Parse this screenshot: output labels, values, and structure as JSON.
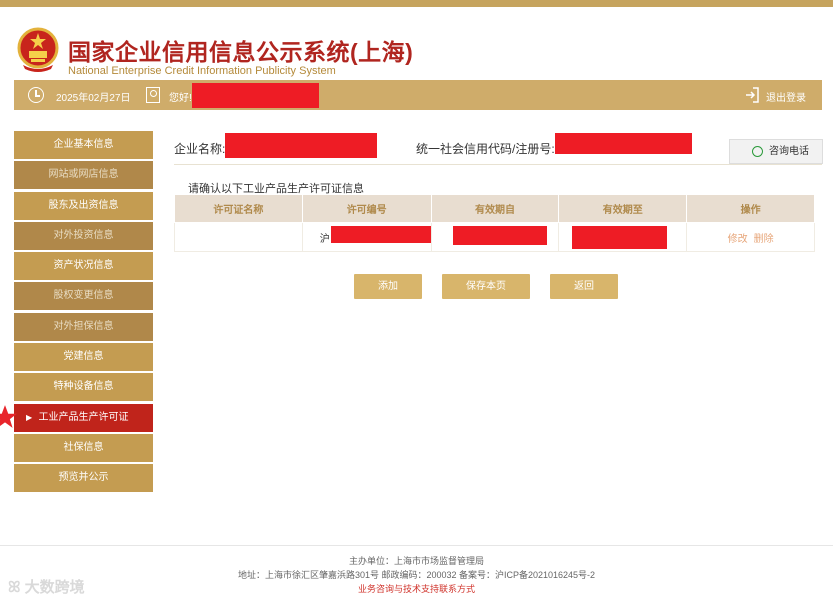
{
  "header": {
    "title_cn": "国家企业信用信息公示系统(上海)",
    "title_en": "National Enterprise Credit Information Publicity System"
  },
  "infobar": {
    "date": "2025年02月27日",
    "hello": "您好!",
    "logout": "退出登录"
  },
  "sidebar": {
    "items": [
      {
        "label": "企业基本信息"
      },
      {
        "label": "网站或网店信息"
      },
      {
        "label": "股东及出资信息"
      },
      {
        "label": "对外投资信息"
      },
      {
        "label": "资产状况信息"
      },
      {
        "label": "股权变更信息"
      },
      {
        "label": "对外担保信息"
      },
      {
        "label": "党建信息"
      },
      {
        "label": "特种设备信息"
      },
      {
        "label": "工业产品生产许可证"
      },
      {
        "label": "社保信息"
      },
      {
        "label": "预览并公示"
      }
    ]
  },
  "main": {
    "company_label": "企业名称:",
    "credit_code_label": "统一社会信用代码/注册号:",
    "consult_button": "咨询电话",
    "subtitle": "请确认以下工业产品生产许可证信息",
    "table": {
      "headers": [
        "许可证名称",
        "许可编号",
        "有效期自",
        "有效期至",
        "操作"
      ],
      "row": {
        "name": "",
        "license_no_prefix": "沪",
        "edit": "修改",
        "delete": "删除"
      }
    },
    "buttons": {
      "add": "添加",
      "save": "保存本页",
      "back": "返回"
    }
  },
  "footer": {
    "sponsor": "主办单位：上海市市场监督管理局",
    "address": "地址：上海市徐汇区肇嘉浜路301号 邮政编码：200032 备案号：沪ICP备2021016245号-2",
    "support": "业务咨询与技术支持联系方式"
  },
  "watermark": "大数跨境",
  "colors": {
    "brand_gold": "#cfac6a",
    "title_red": "#b0251f",
    "active_red": "#c0241b"
  }
}
